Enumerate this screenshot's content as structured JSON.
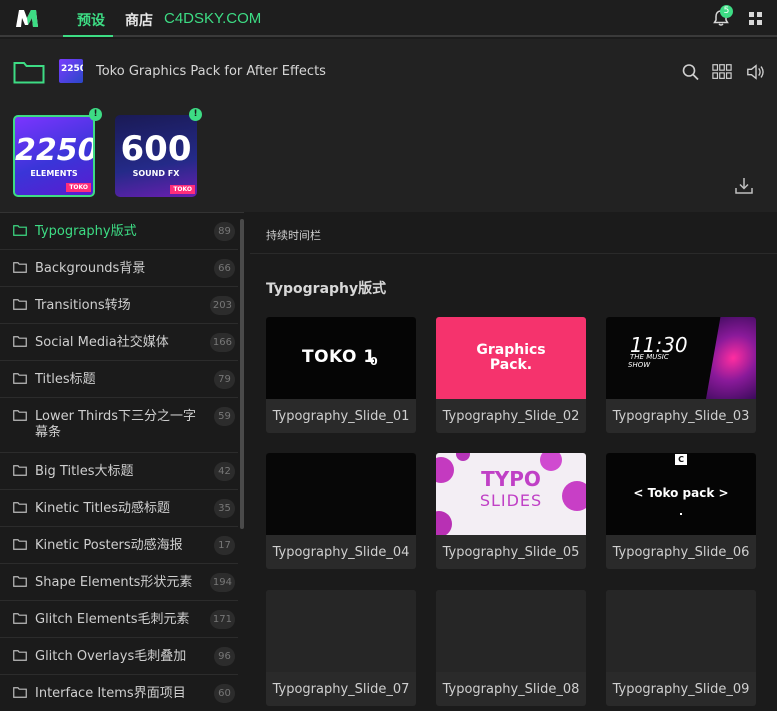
{
  "topbar": {
    "tabs": [
      {
        "label": "预设",
        "active": true
      },
      {
        "label": "商店",
        "active": false
      }
    ],
    "watermark": "C4DSKY.COM",
    "notification_count": "5",
    "accent_color": "#3ddc84"
  },
  "pack": {
    "title": "Toko Graphics Pack for After Effects",
    "header_icons": [
      "search-icon",
      "grid-view-icon",
      "volume-icon"
    ],
    "cards": [
      {
        "big": "2250",
        "small": "ELEMENTS",
        "brand": "TOKO",
        "selected": true,
        "alert": "!"
      },
      {
        "big": "600",
        "small": "SOUND FX",
        "brand": "TOKO",
        "selected": false,
        "alert": "!"
      }
    ]
  },
  "sidebar": {
    "items": [
      {
        "label": "Typography版式",
        "count": "89",
        "active": true
      },
      {
        "label": "Backgrounds背景",
        "count": "66"
      },
      {
        "label": "Transitions转场",
        "count": "203"
      },
      {
        "label": "Social Media社交媒体",
        "count": "166"
      },
      {
        "label": "Titles标题",
        "count": "79"
      },
      {
        "label": "Lower Thirds下三分之一字幕条",
        "count": "59"
      },
      {
        "label": "Big Titles大标题",
        "count": "42"
      },
      {
        "label": "Kinetic Titles动感标题",
        "count": "35"
      },
      {
        "label": "Kinetic Posters动感海报",
        "count": "17"
      },
      {
        "label": "Shape Elements形状元素",
        "count": "194"
      },
      {
        "label": "Glitch Elements毛刺元素",
        "count": "171"
      },
      {
        "label": "Glitch Overlays毛刺叠加",
        "count": "96"
      },
      {
        "label": "Interface Items界面项目",
        "count": "60"
      }
    ]
  },
  "main": {
    "timeline_label": "持续时间栏",
    "section_title": "Typography版式",
    "thumb_text": {
      "t1": "TOKO 1",
      "t1_sub": "0",
      "t2a": "Graphics",
      "t2b": "Pack.",
      "t3a": "11:30",
      "t3b": "THE MUSIC",
      "t3c": "SHOW",
      "t5a": "TYPO",
      "t5b": "SLIDES",
      "t6a": "C",
      "t6b": "< Toko pack >"
    },
    "cards": [
      {
        "caption": "Typography_Slide_01"
      },
      {
        "caption": "Typography_Slide_02"
      },
      {
        "caption": "Typography_Slide_03"
      },
      {
        "caption": "Typography_Slide_04"
      },
      {
        "caption": "Typography_Slide_05"
      },
      {
        "caption": "Typography_Slide_06"
      },
      {
        "caption": "Typography_Slide_07"
      },
      {
        "caption": "Typography_Slide_08"
      },
      {
        "caption": "Typography_Slide_09"
      }
    ]
  }
}
